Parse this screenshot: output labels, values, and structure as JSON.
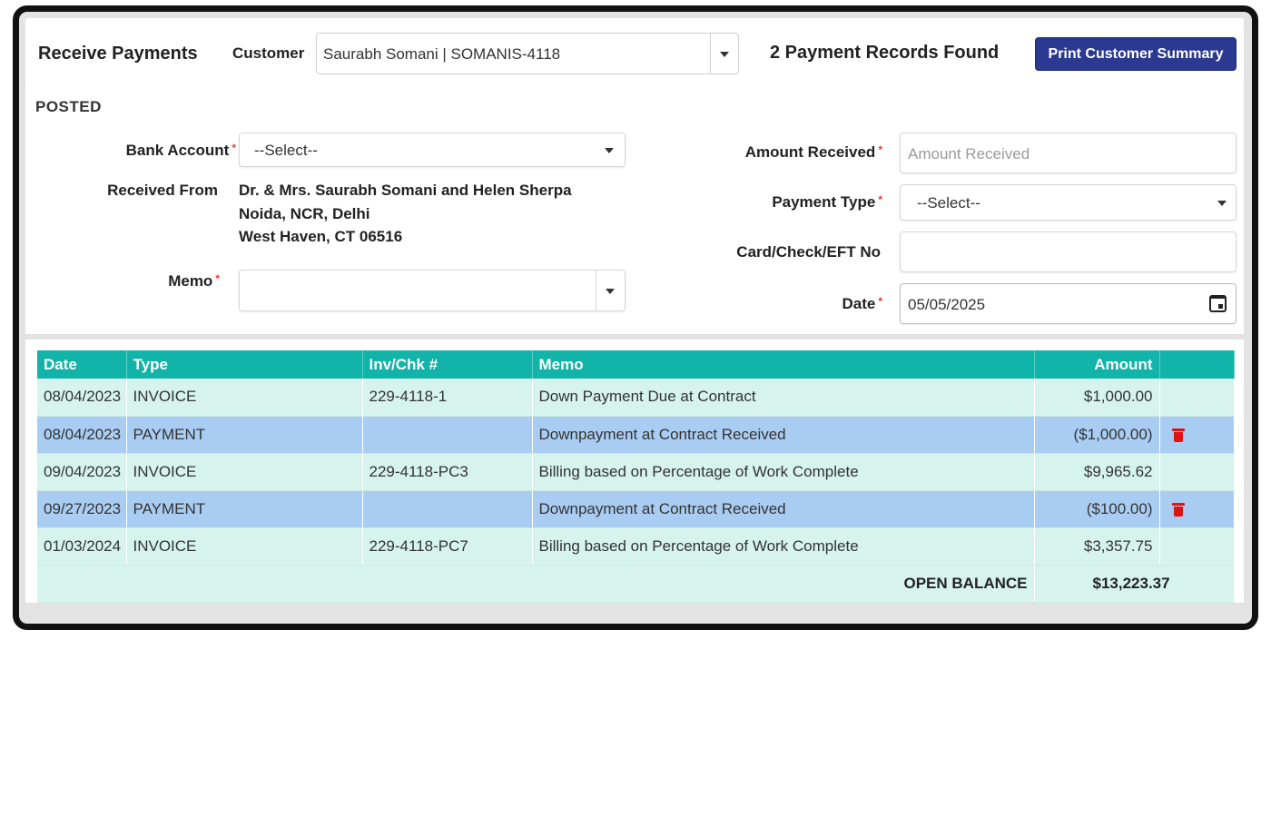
{
  "header": {
    "title": "Receive Payments",
    "customer_label": "Customer",
    "customer_value": "Saurabh Somani | SOMANIS-4118",
    "records_found": "2 Payment Records Found",
    "print_button": "Print Customer Summary"
  },
  "form": {
    "section_title": "POSTED",
    "bank_account_label": "Bank Account",
    "bank_account_value": "--Select--",
    "received_from_label": "Received From",
    "received_from_lines": [
      "Dr. & Mrs. Saurabh Somani and Helen Sherpa",
      "Noida, NCR, Delhi",
      "West Haven, CT 06516"
    ],
    "memo_label": "Memo",
    "memo_value": "",
    "amount_received_label": "Amount Received",
    "amount_received_placeholder": "Amount Received",
    "payment_type_label": "Payment Type",
    "payment_type_value": "--Select--",
    "card_check_label": "Card/Check/EFT No",
    "card_check_value": "",
    "date_label": "Date",
    "date_value": "05/05/2025",
    "required_mark": "*"
  },
  "table": {
    "columns": [
      "Date",
      "Type",
      "Inv/Chk #",
      "Memo",
      "Amount",
      ""
    ],
    "rows": [
      {
        "date": "08/04/2023",
        "type": "INVOICE",
        "inv": "229-4118-1",
        "memo": "Down Payment Due at Contract",
        "amount": "$1,000.00",
        "deletable": false
      },
      {
        "date": "08/04/2023",
        "type": "PAYMENT",
        "inv": "",
        "memo": "Downpayment at Contract Received",
        "amount": "($1,000.00)",
        "deletable": true
      },
      {
        "date": "09/04/2023",
        "type": "INVOICE",
        "inv": "229-4118-PC3",
        "memo": "Billing based on Percentage of Work Complete",
        "amount": "$9,965.62",
        "deletable": false
      },
      {
        "date": "09/27/2023",
        "type": "PAYMENT",
        "inv": "",
        "memo": "Downpayment at Contract Received",
        "amount": "($100.00)",
        "deletable": true
      },
      {
        "date": "01/03/2024",
        "type": "INVOICE",
        "inv": "229-4118-PC7",
        "memo": "Billing based on Percentage of Work Complete",
        "amount": "$3,357.75",
        "deletable": false
      }
    ],
    "open_balance_label": "OPEN BALANCE",
    "open_balance_value": "$13,223.37"
  },
  "colors": {
    "header_teal": "#12b3a8",
    "invoice_row": "#d6f3ee",
    "payment_row": "#a9cdf2",
    "primary_button": "#2b3990",
    "delete_icon": "#e01212",
    "required": "#e53935"
  },
  "icons": [
    "chevron-down-icon",
    "calendar-icon",
    "trash-icon"
  ]
}
